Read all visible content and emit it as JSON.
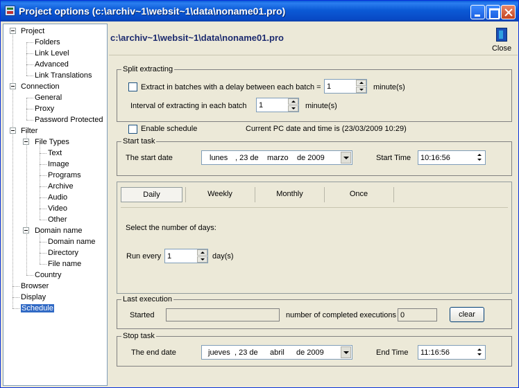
{
  "window": {
    "title": "Project options (c:\\archiv~1\\websit~1\\data\\noname01.pro)"
  },
  "tree": {
    "items": [
      {
        "label": "Project",
        "level": 0,
        "expanded": true
      },
      {
        "label": "Folders",
        "level": 1
      },
      {
        "label": "Link Level",
        "level": 1
      },
      {
        "label": "Advanced",
        "level": 1
      },
      {
        "label": "Link Translations",
        "level": 1
      },
      {
        "label": "Connection",
        "level": 0,
        "expanded": true
      },
      {
        "label": "General",
        "level": 1
      },
      {
        "label": "Proxy",
        "level": 1
      },
      {
        "label": "Password Protected",
        "level": 1
      },
      {
        "label": "Filter",
        "level": 0,
        "expanded": true
      },
      {
        "label": "File Types",
        "level": 1,
        "expanded": true
      },
      {
        "label": "Text",
        "level": 2
      },
      {
        "label": "Image",
        "level": 2
      },
      {
        "label": "Programs",
        "level": 2
      },
      {
        "label": "Archive",
        "level": 2
      },
      {
        "label": "Audio",
        "level": 2
      },
      {
        "label": "Video",
        "level": 2
      },
      {
        "label": "Other",
        "level": 2
      },
      {
        "label": "Domain name",
        "level": 1,
        "expanded": true
      },
      {
        "label": "Domain name",
        "level": 2
      },
      {
        "label": "Directory",
        "level": 2
      },
      {
        "label": "File name",
        "level": 2
      },
      {
        "label": "Country",
        "level": 1
      },
      {
        "label": "Browser",
        "level": 0
      },
      {
        "label": "Display",
        "level": 0
      },
      {
        "label": "Schedule",
        "level": 0,
        "selected": true
      }
    ]
  },
  "header": {
    "path": "c:\\archiv~1\\websit~1\\data\\noname01.pro",
    "close_label": "Close"
  },
  "split": {
    "title": "Split extracting",
    "checkbox_label": "Extract in batches with a delay between each batch =",
    "delay_value": "1",
    "delay_unit": "minute(s)",
    "interval_label": "Interval of extracting in each batch",
    "interval_value": "1",
    "interval_unit": "minute(s)"
  },
  "schedule": {
    "enable_label": "Enable schedule",
    "current_time_text": "Current PC date and time is (23/03/2009 10:29)"
  },
  "start_task": {
    "title": "Start task",
    "date_label": "The start date",
    "date": {
      "weekday": "lunes",
      "day": ", 23 de",
      "month": "marzo",
      "year": "de 2009"
    },
    "time_label": "Start Time",
    "time_value": "10:16:56"
  },
  "frequency": {
    "tabs": [
      "Daily",
      "Weekly",
      "Monthly",
      "Once"
    ],
    "active_tab": 0,
    "instruction": "Select the number of days:",
    "run_every_label": "Run every",
    "run_every_value": "1",
    "run_every_unit": "day(s)"
  },
  "last_execution": {
    "title": "Last execution",
    "started_label": "Started",
    "started_value": "",
    "completed_label": "number of completed executions",
    "completed_value": "0",
    "clear_label": "clear"
  },
  "stop_task": {
    "title": "Stop task",
    "date_label": "The end date",
    "date": {
      "weekday": "jueves",
      "day": ", 23 de",
      "month": "abril",
      "year": "de 2009"
    },
    "time_label": "End Time",
    "time_value": "11:16:56"
  }
}
